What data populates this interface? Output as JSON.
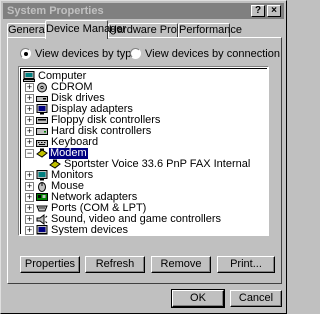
{
  "window": {
    "title": "System Properties",
    "help_button": "?",
    "close_button": "×"
  },
  "tabs": [
    {
      "label": "General",
      "active": false
    },
    {
      "label": "Device Manager",
      "active": true
    },
    {
      "label": "Hardware Profiles",
      "active": false
    },
    {
      "label": "Performance",
      "active": false
    }
  ],
  "view_options": {
    "by_type": {
      "label": "View devices by type",
      "selected": true
    },
    "by_connection": {
      "label": "View devices by connection",
      "selected": false
    }
  },
  "tree": {
    "root": {
      "label": "Computer",
      "icon": "computer-icon"
    },
    "items": [
      {
        "label": "CDROM",
        "icon": "cdrom-icon",
        "expander": "+"
      },
      {
        "label": "Disk drives",
        "icon": "disk-drive-icon",
        "expander": "+"
      },
      {
        "label": "Display adapters",
        "icon": "display-adapter-icon",
        "expander": "+"
      },
      {
        "label": "Floppy disk controllers",
        "icon": "floppy-controller-icon",
        "expander": "+"
      },
      {
        "label": "Hard disk controllers",
        "icon": "hard-disk-controller-icon",
        "expander": "+"
      },
      {
        "label": "Keyboard",
        "icon": "keyboard-icon",
        "expander": "+"
      },
      {
        "label": "Modem",
        "icon": "modem-icon",
        "expander": "−",
        "selected": true
      },
      {
        "label": "Sportster Voice 33.6 PnP FAX Internal",
        "icon": "modem-icon",
        "child": true
      },
      {
        "label": "Monitors",
        "icon": "monitor-icon",
        "expander": "+"
      },
      {
        "label": "Mouse",
        "icon": "mouse-icon",
        "expander": "+"
      },
      {
        "label": "Network adapters",
        "icon": "network-adapter-icon",
        "expander": "+"
      },
      {
        "label": "Ports (COM & LPT)",
        "icon": "port-icon",
        "expander": "+"
      },
      {
        "label": "Sound, video and game controllers",
        "icon": "sound-icon",
        "expander": "+"
      },
      {
        "label": "System devices",
        "icon": "system-device-icon",
        "expander": "+"
      }
    ]
  },
  "buttons": {
    "properties": "Properties",
    "refresh": "Refresh",
    "remove": "Remove",
    "print": "Print...",
    "ok": "OK",
    "cancel": "Cancel"
  }
}
